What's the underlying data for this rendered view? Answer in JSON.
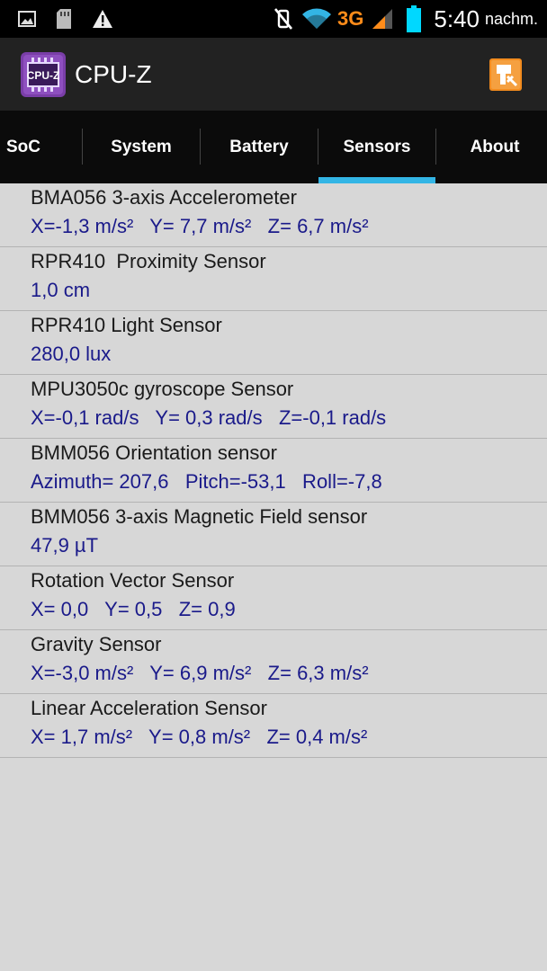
{
  "status_bar": {
    "network_type": "3G",
    "time": "5:40",
    "time_suffix": "nachm.",
    "icons": [
      "image-icon",
      "sd-card-icon",
      "warning-icon",
      "mute-icon",
      "wifi-icon",
      "signal-icon",
      "battery-icon"
    ]
  },
  "app": {
    "title": "CPU-Z",
    "logo_text": "CPU-Z",
    "accent_color": "#33b5e5",
    "action_icon": "settings-action-icon"
  },
  "tabs": [
    {
      "label": "SoC",
      "active": false
    },
    {
      "label": "System",
      "active": false
    },
    {
      "label": "Battery",
      "active": false
    },
    {
      "label": "Sensors",
      "active": true
    },
    {
      "label": "About",
      "active": false
    }
  ],
  "sensors": [
    {
      "name": "BMA056 3-axis Accelerometer",
      "value": "X=-1,3 m/s²   Y= 7,7 m/s²   Z= 6,7 m/s²"
    },
    {
      "name": "RPR410  Proximity Sensor",
      "value": "1,0 cm"
    },
    {
      "name": "RPR410 Light Sensor",
      "value": "280,0 lux"
    },
    {
      "name": "MPU3050c gyroscope Sensor",
      "value": "X=-0,1 rad/s   Y= 0,3 rad/s   Z=-0,1 rad/s"
    },
    {
      "name": "BMM056 Orientation sensor",
      "value": "Azimuth= 207,6   Pitch=-53,1   Roll=-7,8"
    },
    {
      "name": "BMM056 3-axis Magnetic Field sensor",
      "value": "47,9 µT"
    },
    {
      "name": "Rotation Vector Sensor",
      "value": "X= 0,0   Y= 0,5   Z= 0,9"
    },
    {
      "name": "Gravity Sensor",
      "value": "X=-3,0 m/s²   Y= 6,9 m/s²   Z= 6,3 m/s²"
    },
    {
      "name": "Linear Acceleration Sensor",
      "value": "X= 1,7 m/s²   Y= 0,8 m/s²   Z= 0,4 m/s²"
    }
  ]
}
